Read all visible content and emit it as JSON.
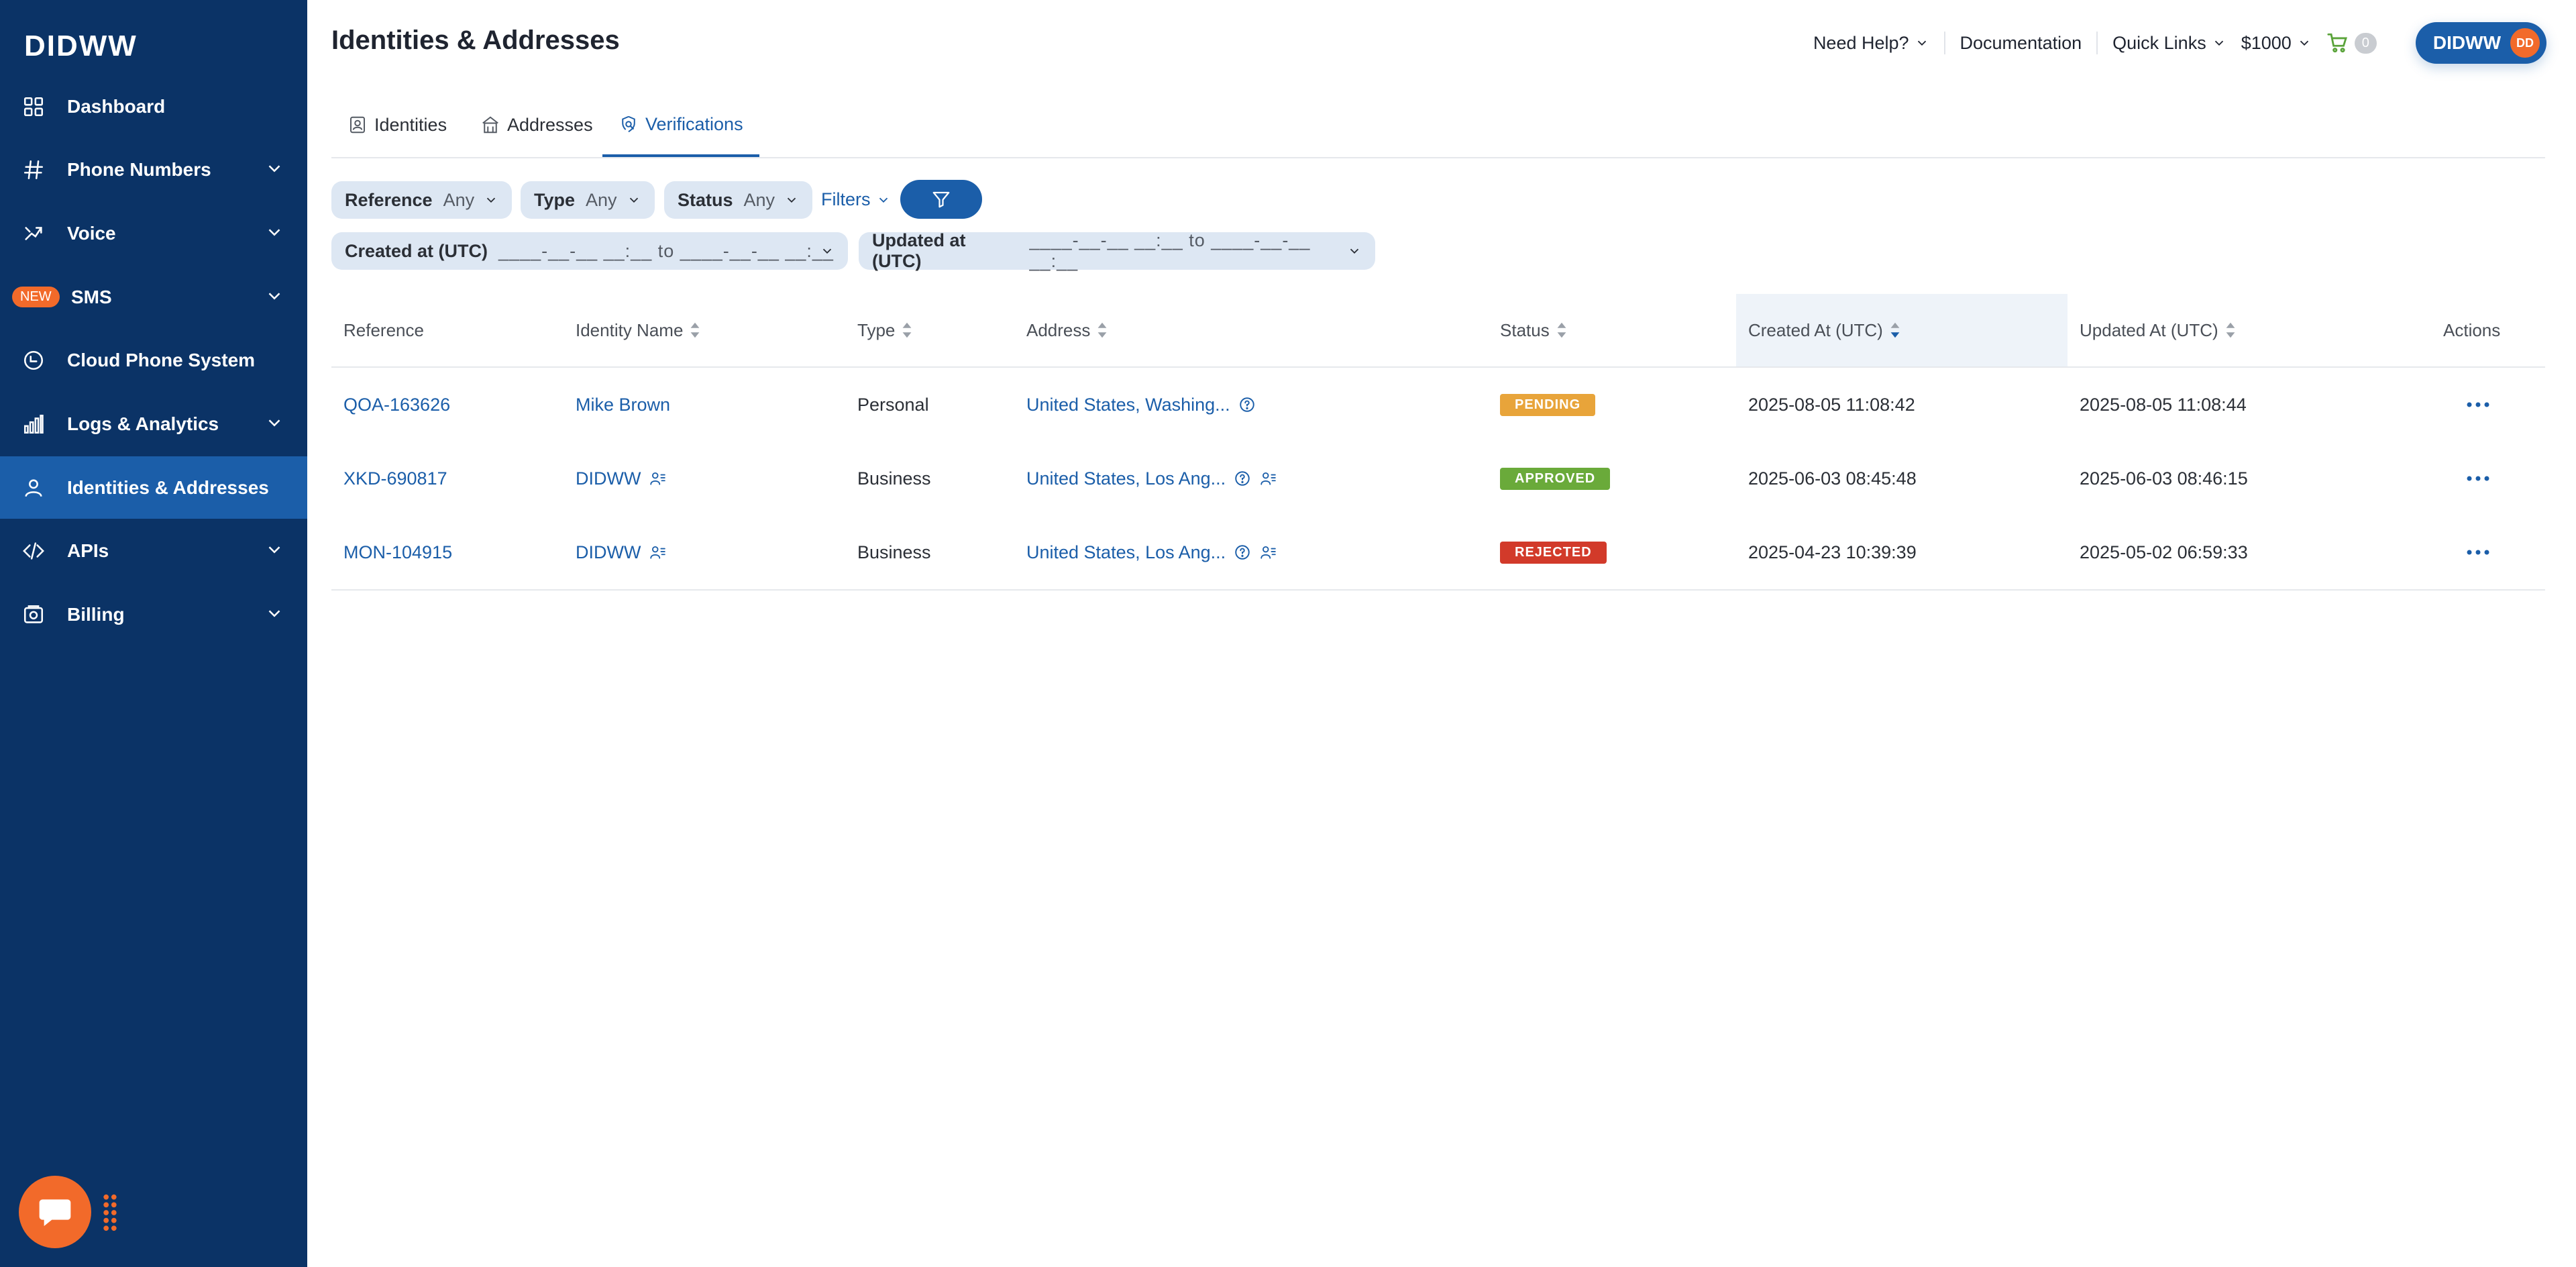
{
  "sidebar": {
    "logo": "DIDWW",
    "items": [
      {
        "label": "Dashboard",
        "icon": "grid-icon",
        "has_children": false
      },
      {
        "label": "Phone Numbers",
        "icon": "hash-icon",
        "has_children": true
      },
      {
        "label": "Voice",
        "icon": "voice-icon",
        "has_children": true
      },
      {
        "label": "SMS",
        "icon": "sms-icon",
        "has_children": true,
        "badge": "NEW"
      },
      {
        "label": "Cloud Phone System",
        "icon": "clock-icon",
        "has_children": false
      },
      {
        "label": "Logs & Analytics",
        "icon": "bar-chart-icon",
        "has_children": true
      },
      {
        "label": "Identities & Addresses",
        "icon": "user-icon",
        "has_children": false,
        "active": true
      },
      {
        "label": "APIs",
        "icon": "code-icon",
        "has_children": true
      },
      {
        "label": "Billing",
        "icon": "billing-icon",
        "has_children": true
      }
    ]
  },
  "header": {
    "title": "Identities & Addresses",
    "need_help": "Need Help?",
    "documentation": "Documentation",
    "quick_links": "Quick Links",
    "balance": "$1000",
    "cart_count": "0",
    "user_name": "DIDWW",
    "user_initials": "DD"
  },
  "tabs": [
    {
      "label": "Identities",
      "icon": "id-card-icon"
    },
    {
      "label": "Addresses",
      "icon": "building-icon"
    },
    {
      "label": "Verifications",
      "icon": "verification-icon",
      "active": true
    }
  ],
  "filters": {
    "reference": {
      "label": "Reference",
      "value": "Any"
    },
    "type": {
      "label": "Type",
      "value": "Any"
    },
    "status": {
      "label": "Status",
      "value": "Any"
    },
    "more": "Filters",
    "created": {
      "label": "Created at (UTC)",
      "value": "____-__-__ __:__ to ____-__-__ __:__"
    },
    "updated": {
      "label": "Updated at (UTC)",
      "value": "____-__-__ __:__ to ____-__-__ __:__"
    }
  },
  "table": {
    "columns": [
      "Reference",
      "Identity Name",
      "Type",
      "Address",
      "Status",
      "Created At (UTC)",
      "Updated At (UTC)",
      "Actions"
    ],
    "rows": [
      {
        "reference": "QOA-163626",
        "identity": "Mike Brown",
        "type": "Personal",
        "address": "United States, Washing...",
        "status": "PENDING",
        "status_color": "#e8a43a",
        "created": "2025-08-05 11:08:42",
        "updated": "2025-08-05 11:08:44",
        "identity_icon": false,
        "address_user_icon": false
      },
      {
        "reference": "XKD-690817",
        "identity": "DIDWW",
        "type": "Business",
        "address": "United States, Los Ang...",
        "status": "APPROVED",
        "status_color": "#6aaa3a",
        "created": "2025-06-03 08:45:48",
        "updated": "2025-06-03 08:46:15",
        "identity_icon": true,
        "address_user_icon": true
      },
      {
        "reference": "MON-104915",
        "identity": "DIDWW",
        "type": "Business",
        "address": "United States, Los Ang...",
        "status": "REJECTED",
        "status_color": "#d23a2a",
        "created": "2025-04-23 10:39:39",
        "updated": "2025-05-02 06:59:33",
        "identity_icon": true,
        "address_user_icon": true
      }
    ]
  },
  "colors": {
    "sidebar": "#0b3366",
    "accent": "#1b5ea9",
    "orange": "#f26a2a"
  }
}
